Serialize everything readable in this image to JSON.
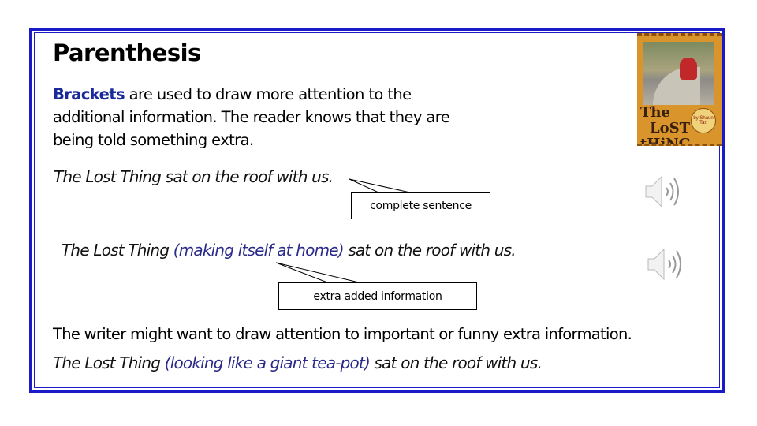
{
  "slide": {
    "title": "Parenthesis",
    "intro": {
      "keyword": "Brackets",
      "rest": " are used to draw more attention to the additional information. The reader knows that they are being told something extra."
    },
    "example1": {
      "text": "The Lost Thing sat on the roof with us.",
      "callout": "complete sentence"
    },
    "example2": {
      "before": "The Lost Thing ",
      "parenthetical": "(making itself at home)",
      "after": " sat on the roof with us.",
      "callout": "extra added information"
    },
    "statement": "The writer might want to draw attention to important or funny extra information.",
    "example3": {
      "before": "The Lost Thing ",
      "parenthetical": "(looking like a giant tea-pot)",
      "after": " sat on the roof with us."
    },
    "cover_image": {
      "label": "The Lost Thing book cover",
      "title_letters": [
        "The",
        "LoST",
        "tHiNG"
      ],
      "author_badge": "by Shaun Tan"
    },
    "audio_icons": [
      "speaker-icon",
      "speaker-icon"
    ],
    "colors": {
      "border": "#1a1ac8",
      "keyword": "#1a2a9a",
      "parenthetical": "#2a2a8a"
    }
  }
}
